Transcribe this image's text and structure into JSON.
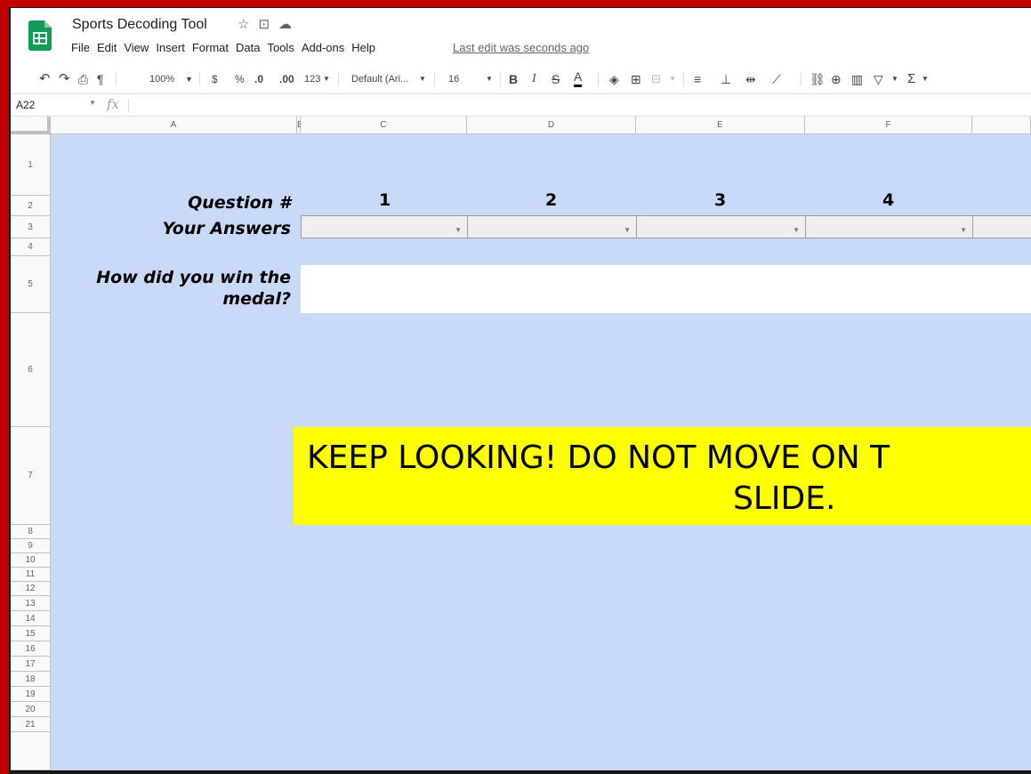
{
  "doc": {
    "title": "Sports Decoding Tool",
    "last_edit": "Last edit was seconds ago"
  },
  "menu": [
    "File",
    "Edit",
    "View",
    "Insert",
    "Format",
    "Data",
    "Tools",
    "Add-ons",
    "Help"
  ],
  "toolbar": {
    "zoom": "100%",
    "currency": "$",
    "percent": "%",
    "decrease_decimal": ".0",
    "increase_decimal": ".00",
    "more_formats": "123",
    "font": "Default (Ari...",
    "font_size": "16",
    "bold": "B",
    "italic": "I",
    "strike": "S",
    "text_color": "A",
    "sum": "Σ"
  },
  "formula_bar": {
    "cell_ref": "A22",
    "fx": "fx"
  },
  "columns": [
    "A",
    "B",
    "C",
    "D",
    "E",
    "F"
  ],
  "rows": [
    "1",
    "2",
    "3",
    "4",
    "5",
    "6",
    "7",
    "8",
    "9",
    "10",
    "11",
    "12",
    "13",
    "14",
    "15",
    "16",
    "17",
    "18",
    "19",
    "20",
    "21"
  ],
  "content": {
    "question_label": "Question #",
    "answers_label": "Your Answers",
    "medal_label_line1": "How did you win the",
    "medal_label_line2": "medal?",
    "question_numbers": [
      "1",
      "2",
      "3",
      "4"
    ],
    "banner_line1": "KEEP LOOKING! DO NOT MOVE ON T",
    "banner_line2": "SLIDE."
  },
  "colors": {
    "frame": "#c00000",
    "sheet_bg": "#c9daf8",
    "banner_bg": "#ffff00",
    "sheets_green": "#0f9d58"
  }
}
